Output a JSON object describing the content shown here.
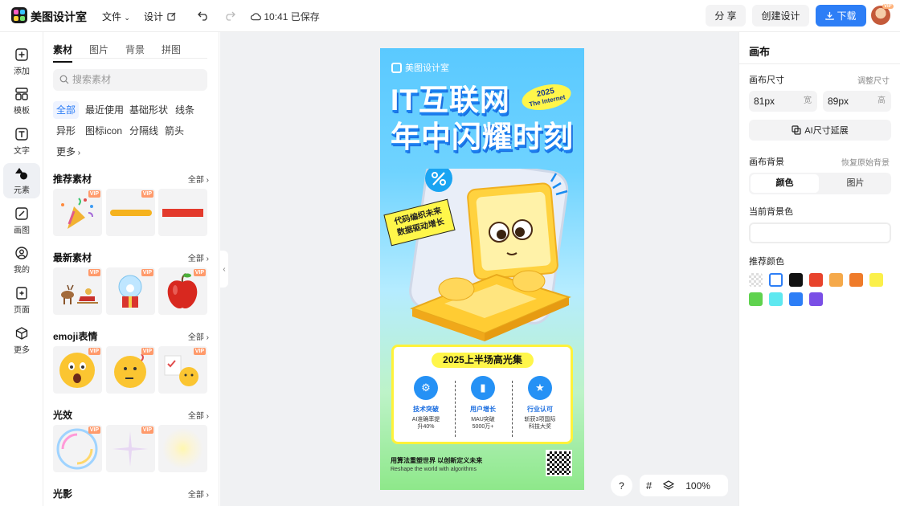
{
  "app": {
    "name": "美图设计室",
    "status_time": "10:41 已保存"
  },
  "topbar": {
    "file_menu": "文件",
    "design_menu": "设计",
    "share_label": "分 享",
    "create_label": "创建设计",
    "download_label": "下载",
    "avatar_badge": "VIP"
  },
  "rail": {
    "items": [
      {
        "label": "添加",
        "icon": "plus-square-icon"
      },
      {
        "label": "模板",
        "icon": "template-icon"
      },
      {
        "label": "文字",
        "icon": "text-icon"
      },
      {
        "label": "元素",
        "icon": "element-icon"
      },
      {
        "label": "画图",
        "icon": "draw-icon"
      },
      {
        "label": "我的",
        "icon": "user-icon"
      },
      {
        "label": "页面",
        "icon": "page-icon"
      },
      {
        "label": "更多",
        "icon": "cube-icon"
      }
    ]
  },
  "panel": {
    "tabs": [
      "素材",
      "图片",
      "背景",
      "拼图"
    ],
    "search_placeholder": "搜索素材",
    "chips": [
      "全部",
      "最近使用",
      "基础形状",
      "线条",
      "异形",
      "图标icon",
      "分隔线",
      "箭头",
      "更多"
    ],
    "all_label": "全部",
    "vip_label": "VIP",
    "sections": [
      "推荐素材",
      "最新素材",
      "emoji表情",
      "光效",
      "光影"
    ]
  },
  "poster": {
    "brand": "美图设计室",
    "title_line1": "IT互联网",
    "title_line2": "年中闪耀时刻",
    "year": "2025",
    "year_sub": "The Internet",
    "tag_line1": "代码编织未来",
    "tag_line2": "数据驱动增长",
    "card_title": "2025上半场高光集",
    "features": [
      {
        "title": "技术突破",
        "desc1": "AI准确率提",
        "desc2": "升40%"
      },
      {
        "title": "用户增长",
        "desc1": "MAU突破",
        "desc2": "5000万+"
      },
      {
        "title": "行业认可",
        "desc1": "斩获3项国际",
        "desc2": "科技大奖"
      }
    ],
    "slogan": "用算法重塑世界 以创新定义未来",
    "slogan_en": "Reshape the world with algorithms"
  },
  "floating": {
    "help": "?",
    "zoom": "100%"
  },
  "right": {
    "title": "画布",
    "size_label": "画布尺寸",
    "adjust_size": "调整尺寸",
    "width_value": "81px",
    "width_unit": "宽",
    "height_value": "89px",
    "height_unit": "高",
    "ai_extend": "AI尺寸延展",
    "bg_label": "画布背景",
    "restore_bg": "恢复原始背景",
    "seg_color": "颜色",
    "seg_image": "图片",
    "current_bg": "当前背景色",
    "recommended": "推荐颜色",
    "swatches": [
      "transparent",
      "#ffffff",
      "#111111",
      "#e8432c",
      "#f5a94a",
      "#ef7b2a",
      "#fbf04a",
      "#5fd24e",
      "#5ee8f0",
      "#2d7ef6",
      "#7a4fe6"
    ]
  }
}
